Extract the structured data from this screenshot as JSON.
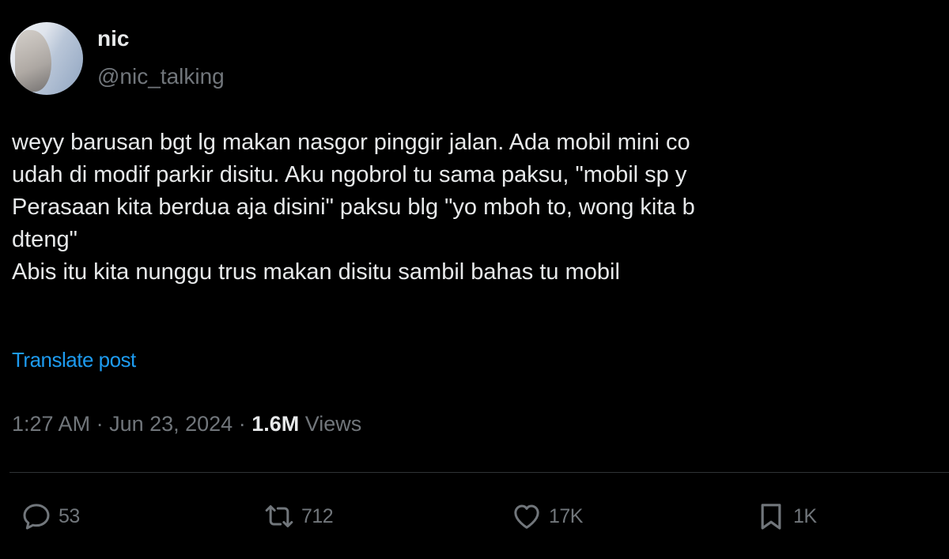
{
  "author": {
    "name": "nic",
    "handle": "@nic_talking"
  },
  "tweet": {
    "lines": [
      "weyy barusan bgt lg makan nasgor pinggir jalan. Ada mobil mini co",
      "udah di modif parkir disitu. Aku ngobrol tu sama paksu, \"mobil sp y",
      "Perasaan kita berdua aja disini\" paksu blg \"yo mboh to, wong kita b",
      "dteng\"",
      "Abis itu kita nunggu trus makan disitu sambil bahas tu mobil"
    ],
    "translate_label": "Translate post"
  },
  "meta": {
    "time": "1:27 AM",
    "separator": " · ",
    "date": "Jun 23, 2024",
    "views_count": "1.6M",
    "views_label": " Views"
  },
  "actions": {
    "replies": {
      "icon": "reply-icon",
      "count": "53"
    },
    "reposts": {
      "icon": "repost-icon",
      "count": "712"
    },
    "likes": {
      "icon": "heart-icon",
      "count": "17K"
    },
    "bookmarks": {
      "icon": "bookmark-icon",
      "count": "1K"
    }
  },
  "colors": {
    "background": "#000000",
    "text": "#e7e9ea",
    "muted": "#71767b",
    "link": "#1d9bf0",
    "divider": "#2f3336"
  }
}
